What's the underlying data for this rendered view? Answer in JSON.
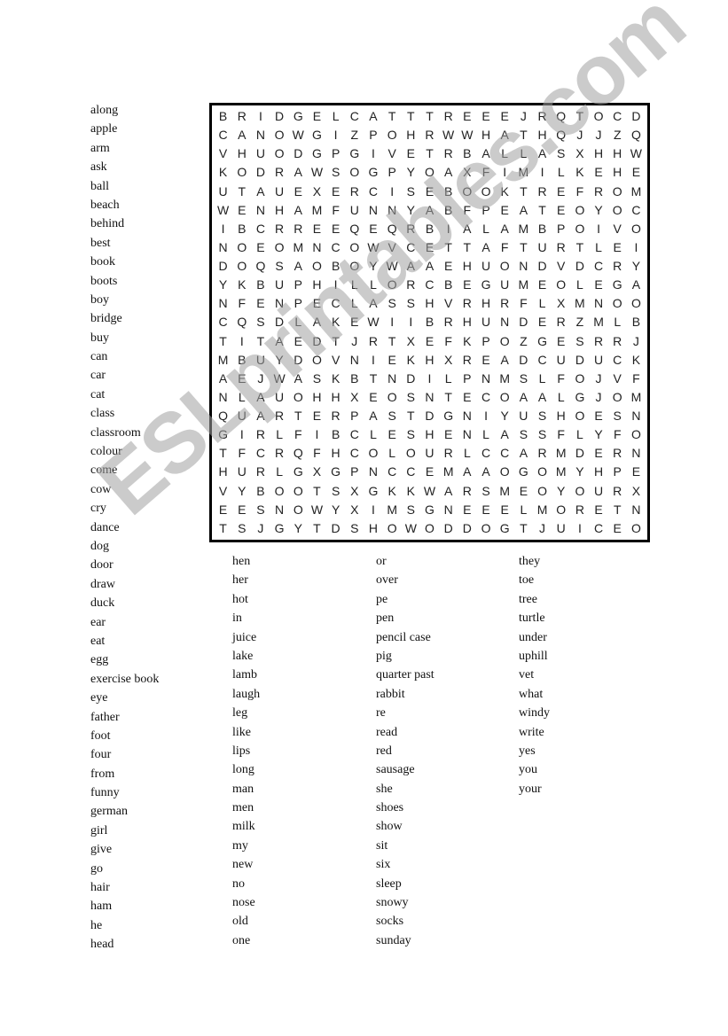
{
  "watermark": "ESLprintables.com",
  "grid_rows": [
    "BRIDGELCATTTREEEJRQTOCD",
    "CANOWGIZPOHRWWHATHQJJZQ",
    "VHUODGPGIVETRBALLASXHHW",
    "KODRAWSOGPYOAXFIMILKEHE",
    "UTAUEXERCISEBOOKTREFROM",
    "WENHAMFUNNYABFPEATEOYOC",
    "IBCRREEQEQRBIALAMBPOIVO",
    "NOEOMNCOWVCETTAFTURTLEI",
    "DOQSAOBOYWAAEHUONDVDCRY",
    "YKBUPHILLORCBEGUMEOLEGA",
    "NFENPECLASSHVRHRFLXMNOO",
    "CQSDLAKEWIIBRHUNDERZMLB",
    "TITAEDTJRTXEFKPOZGESRRJ",
    "MBUYDOVNIEKHXREADCUDUCK",
    "AEJWASKBTNDILPNMSLFOJVF",
    "NLAUOHHXEOSNTECOAALGJOM",
    "QUARTERPASTDGNIYUSHOESN",
    "GIRLFIBCLESHENLASSFLYFO",
    "TFCRQFHCOLOURLCCARMDERN",
    "HURLGXGPNCCEMAAOGOMYHPE",
    "VYBOOTSXGKKWARSMEOYOURX",
    "EESNOWYXIMSGNEEELMORETN",
    "TSJGYTDSHOWODDOGTJUICEO"
  ],
  "word_columns": [
    [
      "along",
      "apple",
      "arm",
      "ask",
      "ball",
      "beach",
      "behind",
      "best",
      "book",
      "boots",
      "boy",
      "bridge",
      "buy",
      "can",
      "car",
      "cat",
      "class",
      "classroom",
      "colour",
      "come",
      "cow",
      "cry",
      "dance",
      "dog",
      "door",
      "draw",
      "duck",
      "ear",
      "eat",
      "egg",
      "exercise book",
      "eye",
      "father",
      "foot",
      "four",
      "from",
      "funny",
      "german",
      "girl",
      "give",
      "go",
      "hair",
      "ham",
      "he",
      "head"
    ],
    [
      "hen",
      "her",
      "hot",
      "in",
      "juice",
      "lake",
      "lamb",
      "laugh",
      "leg",
      "like",
      "lips",
      "long",
      "man",
      "men",
      "milk",
      "my",
      "new",
      "no",
      "nose",
      "old",
      "one"
    ],
    [
      "or",
      "over",
      "pe",
      "pen",
      "pencil case",
      "pig",
      "quarter past",
      "rabbit",
      "re",
      "read",
      "red",
      "sausage",
      "she",
      "shoes",
      "show",
      "sit",
      "six",
      "sleep",
      "snowy",
      "socks",
      "sunday"
    ],
    [
      "they",
      "toe",
      "tree",
      "turtle",
      "under",
      "uphill",
      "vet",
      "what",
      "windy",
      "write",
      "yes",
      "you",
      "your"
    ]
  ]
}
